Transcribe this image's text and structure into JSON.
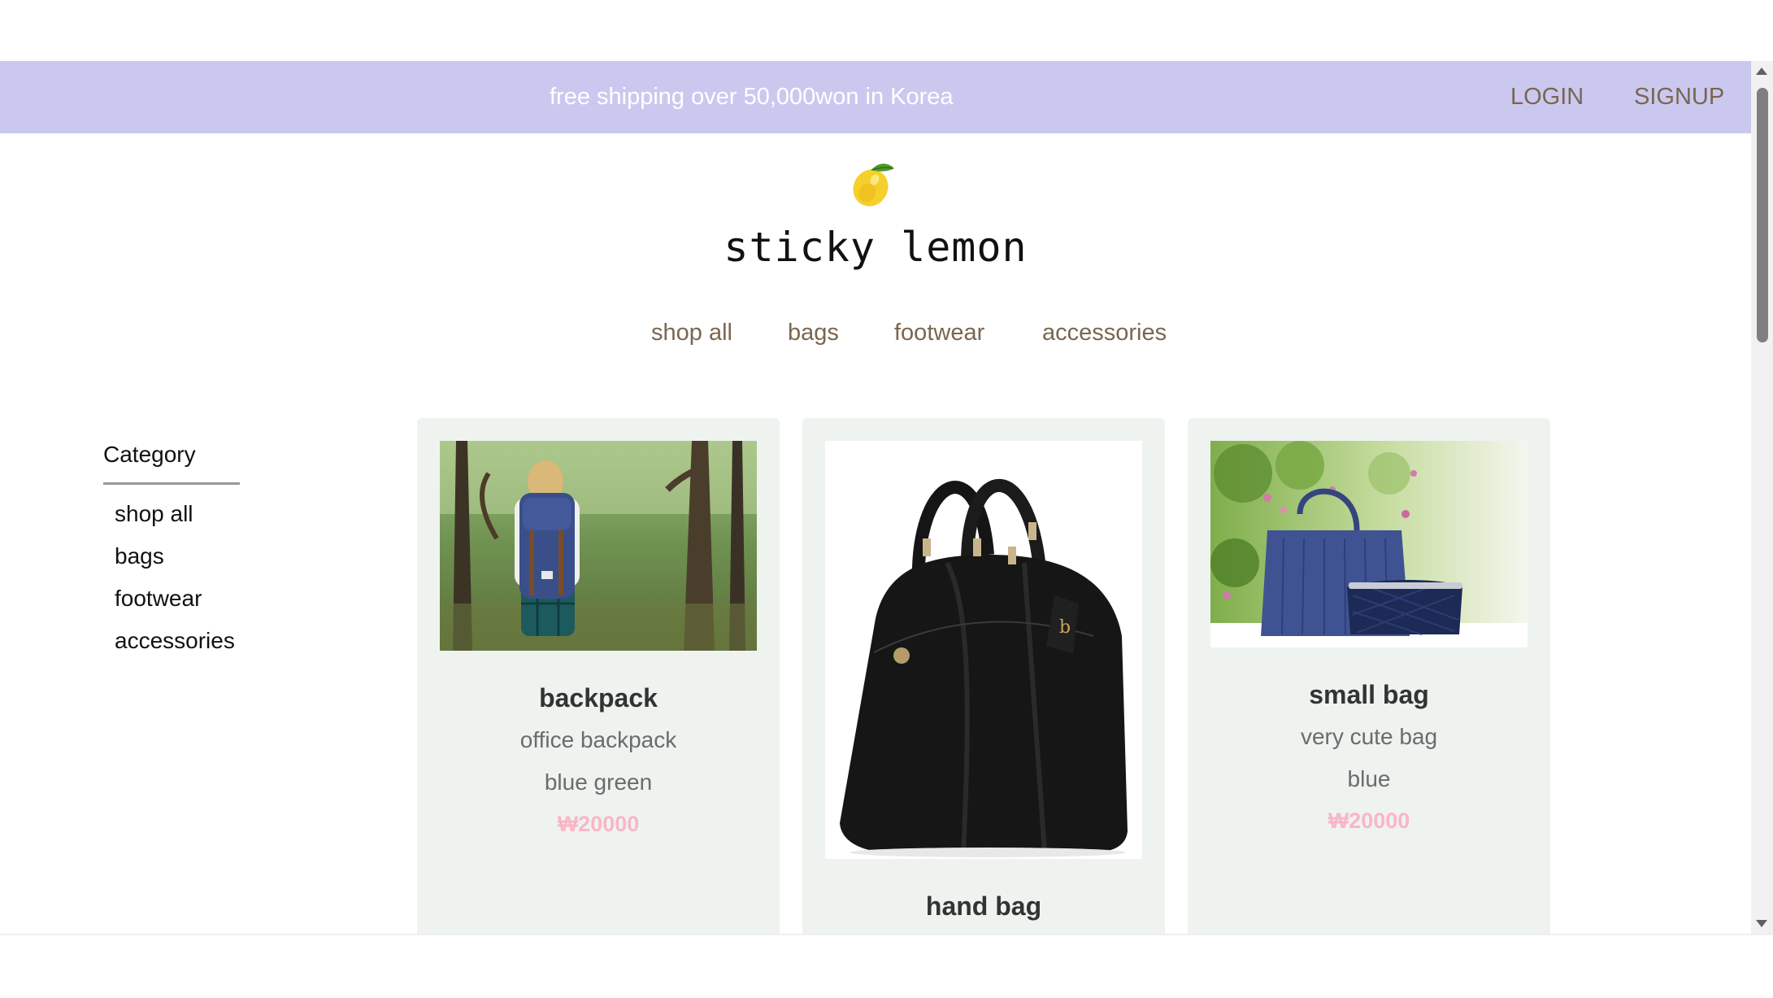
{
  "topbar": {
    "promo": "free shipping over 50,000won in Korea",
    "login": "LOGIN",
    "signup": "SIGNUP",
    "background": "#cbc8f0"
  },
  "brand": {
    "icon": "lemon-icon",
    "name": "sticky lemon"
  },
  "nav": {
    "items": [
      "shop all",
      "bags",
      "footwear",
      "accessories"
    ]
  },
  "sidebar": {
    "title": "Category",
    "items": [
      "shop all",
      "bags",
      "footwear",
      "accessories"
    ]
  },
  "products": [
    {
      "name": "backpack",
      "description": "office backpack",
      "color": "blue green",
      "price": "₩20000",
      "image": "backpack-photo"
    },
    {
      "name": "hand bag",
      "image": "handbag-photo"
    },
    {
      "name": "small bag",
      "description": "very cute bag",
      "color": "blue",
      "price": "₩20000",
      "image": "small-bag-photo"
    }
  ],
  "colors": {
    "price": "#f8b7c6",
    "nav_text": "#7a6650",
    "card_bg": "#eff3f0"
  }
}
